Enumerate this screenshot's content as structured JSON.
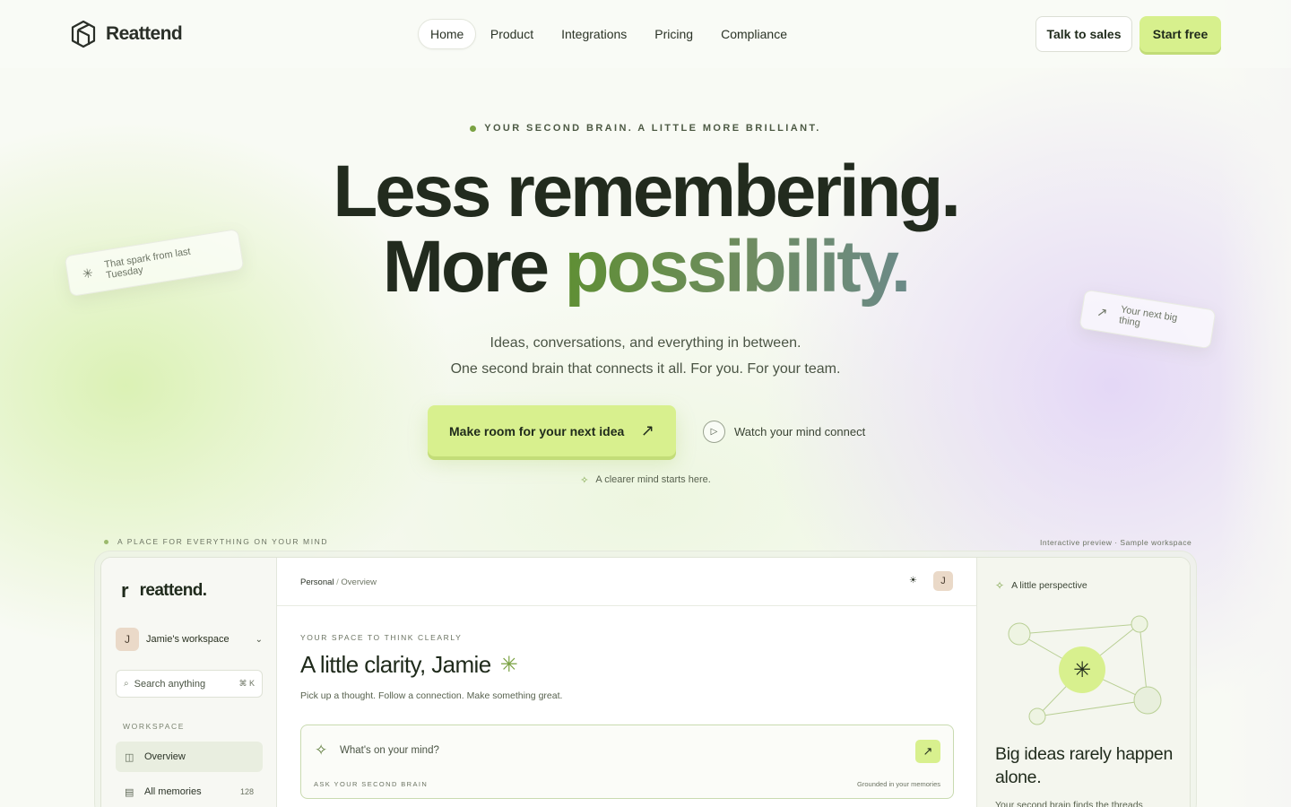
{
  "nav": {
    "brand": "Reattend",
    "menu": [
      "Home",
      "Product",
      "Integrations",
      "Pricing",
      "Compliance"
    ],
    "talk_to_sales": "Talk to sales",
    "start_free": "Start free"
  },
  "hero": {
    "eyebrow": "YOUR SECOND BRAIN. A LITTLE MORE BRILLIANT.",
    "headline_line1": "Less remembering.",
    "headline_line2_plain": "More ",
    "headline_line2_accent": "possibility.",
    "sub_line1": "Ideas, conversations, and everything in between.",
    "sub_line2": "One second brain that connects it all. For you. For your team.",
    "cta_label": "Make room for your next idea",
    "cta_arrow": "↗",
    "watch_label": "Watch your mind connect",
    "clearer": "A clearer mind starts here.",
    "float_card_1": "That spark from last Tuesday",
    "float_card_2": "Your next big thing"
  },
  "section": {
    "label": "A PLACE FOR EVERYTHING ON YOUR MIND",
    "preview_note": "Interactive preview · Sample workspace"
  },
  "app": {
    "logo_mark": "r",
    "logo_text": "reattend.",
    "workspace_initial": "J",
    "workspace_name": "Jamie's workspace",
    "search_placeholder": "Search anything",
    "search_shortcut": "⌘ K",
    "sidebar_section": "WORKSPACE",
    "sidebar_items": [
      {
        "label": "Overview",
        "count": ""
      },
      {
        "label": "All memories",
        "count": "128"
      }
    ],
    "breadcrumb_root": "Personal",
    "breadcrumb_sep": " / ",
    "breadcrumb_current": "Overview",
    "user_initial": "J",
    "main_eyebrow": "YOUR SPACE TO THINK CLEARLY",
    "main_title": "A little clarity, Jamie",
    "main_sub": "Pick up a thought. Follow a connection. Make something great.",
    "ask_placeholder": "What's on your mind?",
    "ask_label": "ASK YOUR SECOND BRAIN",
    "ask_grounded": "Grounded in your memories",
    "ask_go": "↗",
    "panel_head": "A little perspective",
    "panel_title": "Big ideas rarely happen alone.",
    "panel_sub": "Your second brain finds the threads"
  },
  "colors": {
    "accent_lime": "#d8f08e",
    "accent_green": "#7aa243",
    "ink": "#222b1e"
  }
}
